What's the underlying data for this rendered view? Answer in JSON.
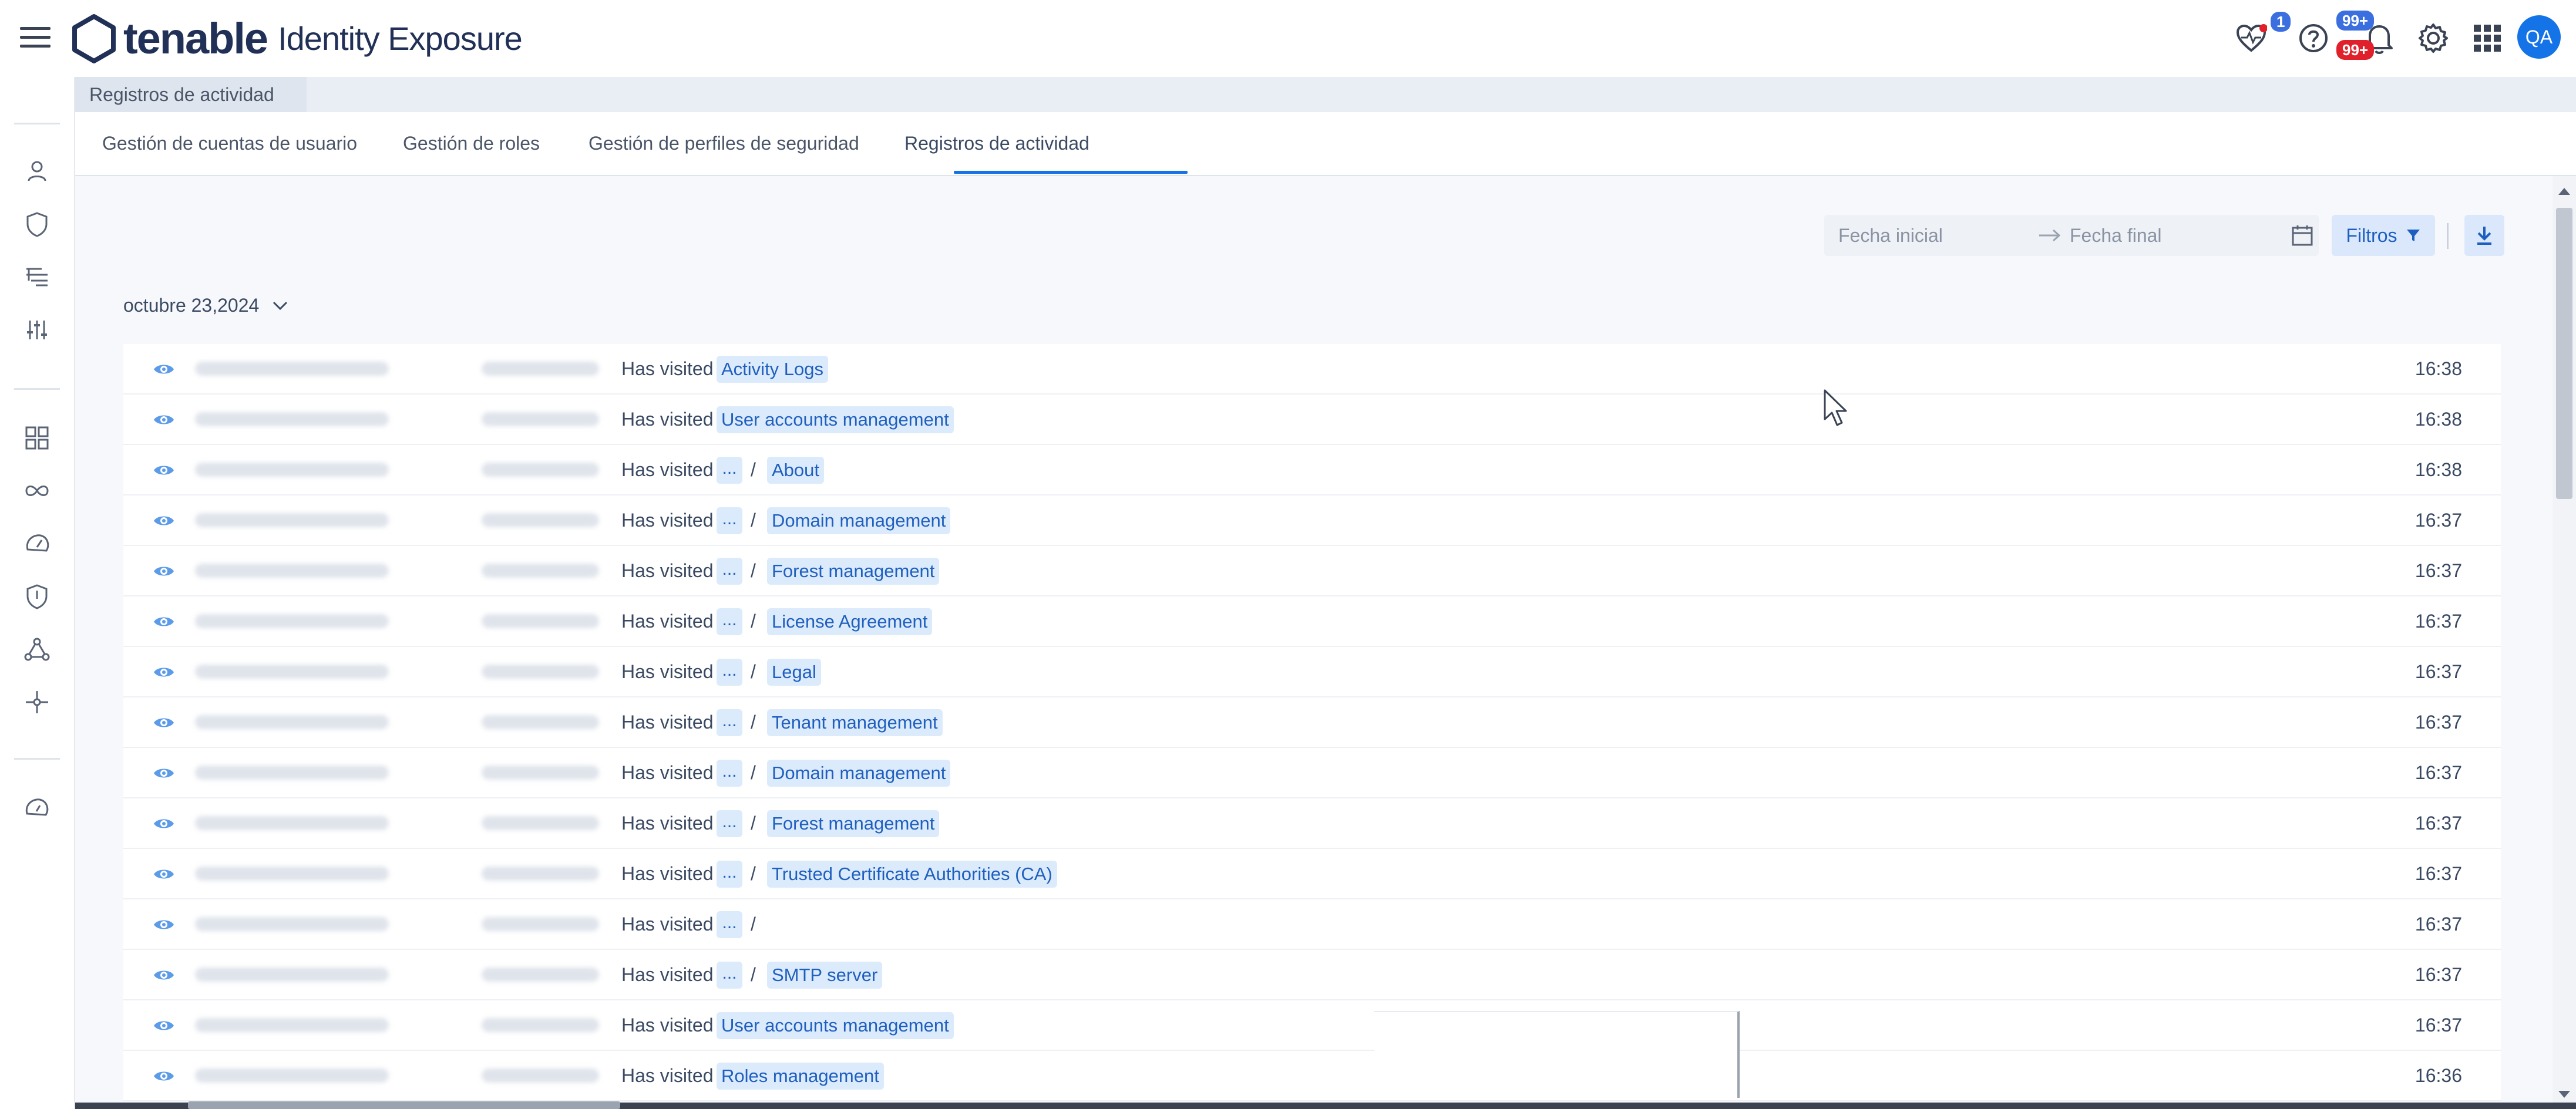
{
  "app": {
    "brand": "tenable",
    "product": "Identity Exposure",
    "avatar_initials": "QA",
    "badges": {
      "health": "1",
      "notif_top": "99+",
      "notif_bottom": "99+"
    }
  },
  "breadcrumb": {
    "current": "Registros de actividad"
  },
  "tabs": [
    {
      "label": "Gestión de cuentas de usuario"
    },
    {
      "label": "Gestión de roles"
    },
    {
      "label": "Gestión de perfiles de seguridad"
    },
    {
      "label": "Registros de actividad",
      "active": true
    }
  ],
  "toolbar": {
    "start_placeholder": "Fecha inicial",
    "end_placeholder": "Fecha final",
    "filters_label": "Filtros"
  },
  "log": {
    "date_group": "octubre 23,2024",
    "rows": [
      {
        "action": "Has visited",
        "ellipsis": false,
        "page": "Activity Logs",
        "time": "16:38"
      },
      {
        "action": "Has visited",
        "ellipsis": false,
        "page": "User accounts management",
        "time": "16:38"
      },
      {
        "action": "Has visited",
        "ellipsis": true,
        "page": "About",
        "time": "16:38"
      },
      {
        "action": "Has visited",
        "ellipsis": true,
        "page": "Domain management",
        "time": "16:37"
      },
      {
        "action": "Has visited",
        "ellipsis": true,
        "page": "Forest management",
        "time": "16:37"
      },
      {
        "action": "Has visited",
        "ellipsis": true,
        "page": "License Agreement",
        "time": "16:37"
      },
      {
        "action": "Has visited",
        "ellipsis": true,
        "page": "Legal",
        "time": "16:37"
      },
      {
        "action": "Has visited",
        "ellipsis": true,
        "page": "Tenant management",
        "time": "16:37"
      },
      {
        "action": "Has visited",
        "ellipsis": true,
        "page": "Domain management",
        "time": "16:37"
      },
      {
        "action": "Has visited",
        "ellipsis": true,
        "page": "Forest management",
        "time": "16:37"
      },
      {
        "action": "Has visited",
        "ellipsis": true,
        "page": "Trusted Certificate Authorities (CA)",
        "time": "16:37"
      },
      {
        "action": "Has visited",
        "ellipsis": true,
        "page": "",
        "time": "16:37"
      },
      {
        "action": "Has visited",
        "ellipsis": true,
        "page": "SMTP server",
        "time": "16:37"
      },
      {
        "action": "Has visited",
        "ellipsis": false,
        "page": "User accounts management",
        "time": "16:37"
      },
      {
        "action": "Has visited",
        "ellipsis": false,
        "page": "Roles management",
        "time": "16:36"
      }
    ]
  },
  "colors": {
    "accent": "#1473e6",
    "chip_bg": "#dcebfb",
    "chip_text": "#1f5fbf",
    "badge_blue": "#3b6fe0",
    "badge_red": "#e0202a"
  }
}
